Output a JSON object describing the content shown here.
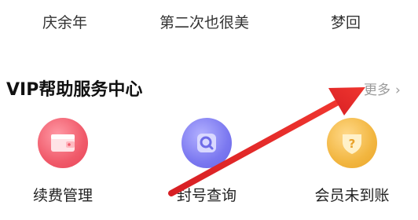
{
  "top_row": {
    "items": [
      "庆余年",
      "第二次也很美",
      "梦回"
    ]
  },
  "section": {
    "title": "VIP帮助服务中心",
    "more_label": "更多",
    "more_chevron": "›"
  },
  "services": [
    {
      "label": "续费管理",
      "icon": "wallet-icon",
      "color": "#f05a6a"
    },
    {
      "label": "封号查询",
      "icon": "search-magnifier-icon",
      "color": "#7b78f0"
    },
    {
      "label": "会员未到账",
      "icon": "question-shield-icon",
      "color": "#f2b640"
    }
  ],
  "annotation": {
    "arrow_color": "#e8262a"
  }
}
